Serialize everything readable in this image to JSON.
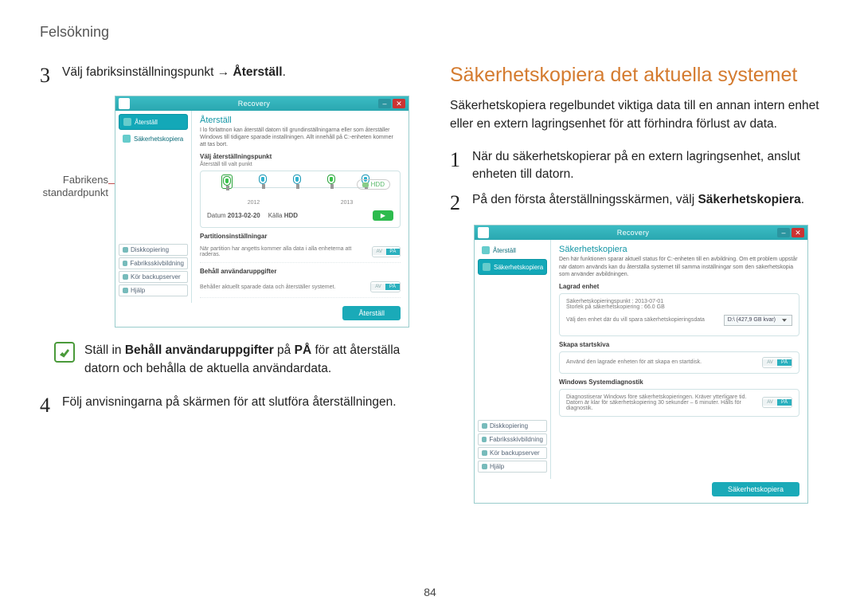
{
  "page": {
    "header": "Felsökning",
    "number": "84"
  },
  "left": {
    "step3_prefix": "Välj fabriksinställningspunkt → ",
    "step3_bold": "Återställ",
    "step3_suffix": ".",
    "callout": "Fabrikens standardpunkt",
    "note_prefix": "Ställ in ",
    "note_bold1": "Behåll användaruppgifter",
    "note_mid": " på ",
    "note_bold2": "PÅ",
    "note_suffix": " för att återställa datorn och behålla de aktuella användardata.",
    "step4": "Följ anvisningarna på skärmen för att slutföra återställningen."
  },
  "right": {
    "heading": "Säkerhetskopiera det aktuella systemet",
    "intro": "Säkerhetskopiera regelbundet viktiga data till en annan intern enhet eller en extern lagringsenhet för att förhindra förlust av data.",
    "step1": "När du säkerhetskopierar på en extern lagringsenhet, anslut enheten till datorn.",
    "step2_prefix": "På den första återställningsskärmen, välj ",
    "step2_bold": "Säkerhetskopiera",
    "step2_suffix": "."
  },
  "app": {
    "title": "Recovery",
    "sidebar": {
      "restore": "Återställ",
      "backup": "Säkerhetskopiera",
      "disk_copy": "Diskkopiering",
      "factory_disk": "Fabriksskivbildning",
      "run_backup_server": "Kör backupserver",
      "help": "Hjälp"
    },
    "restore_screen": {
      "title": "Återställ",
      "desc": "I lo förlattnon kan återställ datorn till grundinställningarna eller som återställer Windows till tidigare sparade installningen. Allt innehåll på C:-enheten kommer att tas bort.",
      "section_point": "Välj återställningspunkt",
      "point_sub": "Återställ till valt punkt",
      "years": [
        "2012",
        "2013"
      ],
      "datum_label": "Datum",
      "datum": "2013-02-20",
      "kalla_label": "Källa",
      "kalla": "HDD",
      "hdd_pill": "HDD",
      "section_partition": "Partitionsinställningar",
      "partition_text": "När partition har angetts kommer alla data i alla enheterna att raderas.",
      "section_keepuser": "Behåll användaruppgifter",
      "keepuser_text": "Behåller aktuellt sparade data och återställer systemet.",
      "toggle_av": "AV",
      "toggle_pa": "PÅ",
      "action": "Återställ"
    },
    "backup_screen": {
      "title": "Säkerhetskopiera",
      "desc": "Den här funktionen sparar aktuell status för C:-enheten till en avbildning. Om ett problem uppstår när datorn används kan du återställa systemet till samma inställningar som den säkerhetskopia som använder avbildningen.",
      "section_drive": "Lagrad enhet",
      "drive_line1": "Säkerhetskopieringspunkt : 2013-07-01",
      "drive_line2": "Storlek på säkerhetskopiering : 66.0 GB",
      "drive_line3": "Välj den enhet där du vill spara säkerhetskopieringsdata",
      "drive_select": "D:\\ (427,9 GB kvar)",
      "section_startdisk": "Skapa startskiva",
      "startdisk_text": "Använd den lagrade enheten för att skapa en startdisk.",
      "section_diag": "Windows Systemdiagnostik",
      "diag_text": "Diagnostiserar Windows före säkerhetskopieringen. Kräver ytterligare tid. Datorn är klar för säkerhetskopiering 30 sekunder – 6 minuter. Hålls för diagnostik.",
      "action": "Säkerhetskopiera"
    }
  }
}
